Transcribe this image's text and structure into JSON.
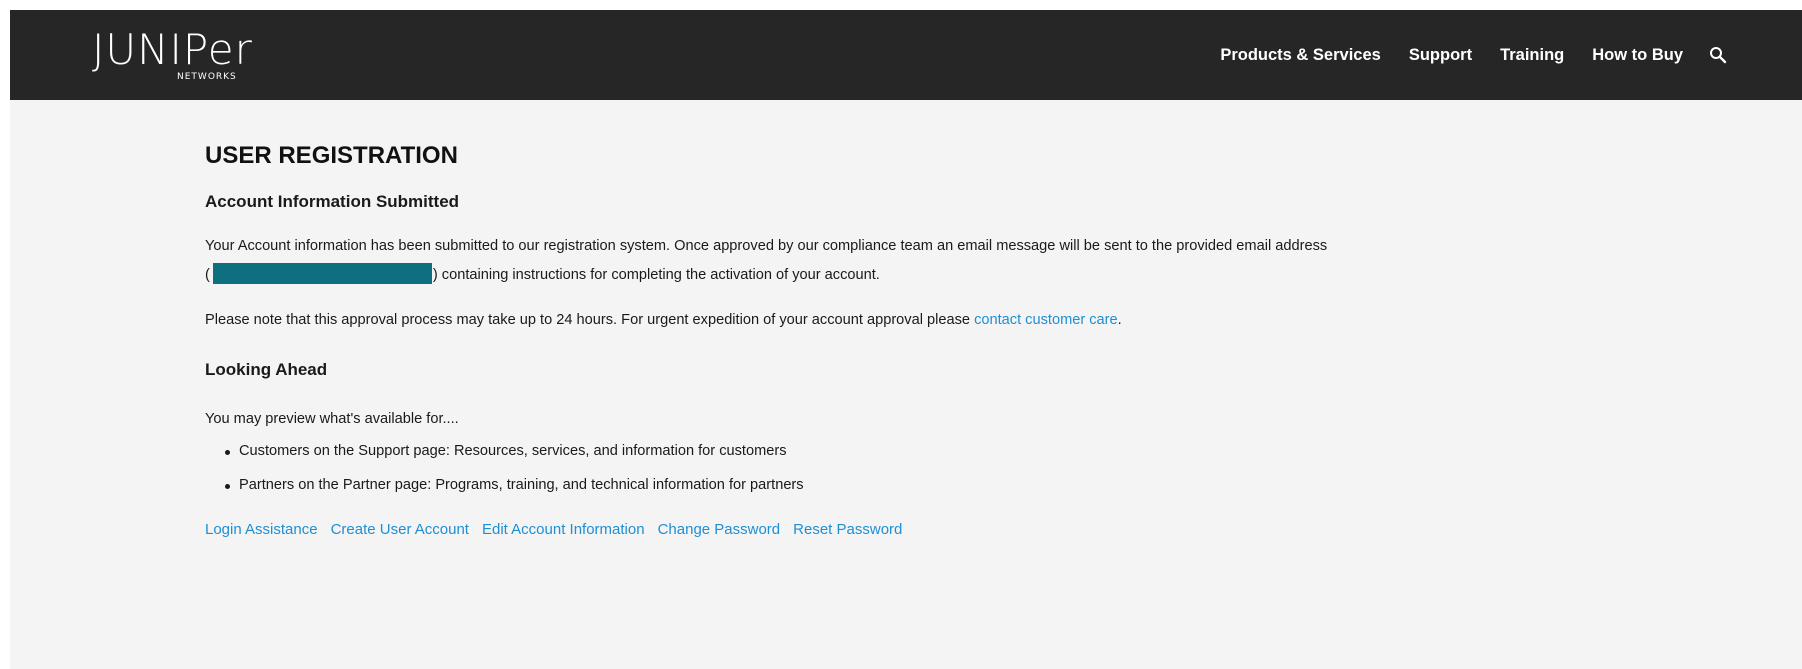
{
  "header": {
    "logo_text": "JUNIPer",
    "logo_subtext": "NETWORKS",
    "nav": [
      {
        "label": "Products & Services"
      },
      {
        "label": "Support"
      },
      {
        "label": "Training"
      },
      {
        "label": "How to Buy"
      }
    ],
    "search_icon": "search-icon"
  },
  "main": {
    "title": "USER REGISTRATION",
    "submitted_heading": "Account Information Submitted",
    "submitted_line1": "Your Account information has been submitted to our registration system. Once approved by our compliance team an email message will be sent to the provided email address",
    "submitted_line2_open": "(",
    "submitted_line2_rest": ") containing instructions for completing the activation of your account.",
    "approval_text": "Please note that this approval process may take up to 24 hours. For urgent expedition of your account approval please",
    "approval_link": "contact customer care",
    "approval_end": ".",
    "ahead_heading": "Looking Ahead",
    "preview_text": "You may preview what's available for....",
    "bullets": [
      "Customers on the Support page: Resources, services, and information for customers",
      "Partners on the Partner page: Programs, training, and technical information for partners"
    ],
    "footer_links": [
      "Login Assistance",
      "Create User Account",
      "Edit Account Information",
      "Change Password",
      "Reset Password"
    ]
  },
  "colors": {
    "header_bg": "#262626",
    "content_bg": "#f4f4f4",
    "link": "#1e8fd4",
    "redaction": "#0d6f7f"
  }
}
